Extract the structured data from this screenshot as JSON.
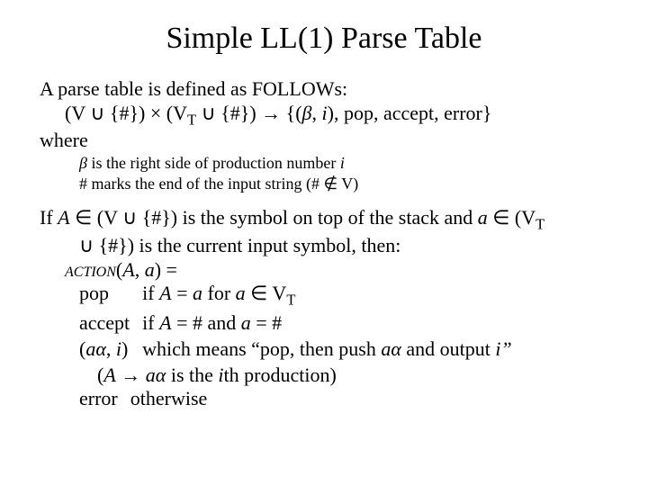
{
  "title": "Simple LL(1) Parse Table",
  "intro": "A parse table is defined as FOLLOWs:",
  "mapping": "(V ∪ {#}) × (V",
  "mapping_sub": "T",
  "mapping2": " ∪ {#}) → {(",
  "beta": "β",
  "mapping3": ", ",
  "i_var": "i",
  "mapping4": "), pop, accept, error}",
  "where": "where",
  "note1a": "β",
  "note1b": " is the right side of production number ",
  "note1c": "i",
  "note2": "# marks the end of the input string (# ∉ V)",
  "para2_a": "If ",
  "A": "A",
  "para2_b": " ∈ (V ∪ {#}) is the symbol on top of the stack and ",
  "a": "a",
  "para2_c": " ∈ (V",
  "para2_sub": "T",
  "para2_d": " ∪ {#}) is the current input symbol, then:",
  "action_label": "ACTION",
  "action_args_open": "(",
  "action_args_mid": ", ",
  "action_args_close": ") =",
  "case_pop": "pop",
  "case_pop_cond_a": "if ",
  "case_pop_cond_b": " = ",
  "case_pop_cond_c": " for ",
  "case_pop_cond_d": " ∈ V",
  "case_pop_sub": "T",
  "case_accept": "accept",
  "case_accept_cond_a": "if ",
  "case_accept_cond_b": " = # and ",
  "case_accept_cond_c": " = #",
  "case_tuple_open": "(",
  "alpha": "α",
  "case_tuple_mid": ", ",
  "case_tuple_close": ")",
  "case_tuple_cond_a": "which means “pop, then push ",
  "case_tuple_cond_b": " and output ",
  "case_tuple_cond_c": "”",
  "case_tuple_note_a": "(",
  "case_tuple_note_b": " → ",
  "case_tuple_note_c": " is the ",
  "case_tuple_note_d": "th production)",
  "case_error": "error",
  "case_error_cond": "otherwise"
}
